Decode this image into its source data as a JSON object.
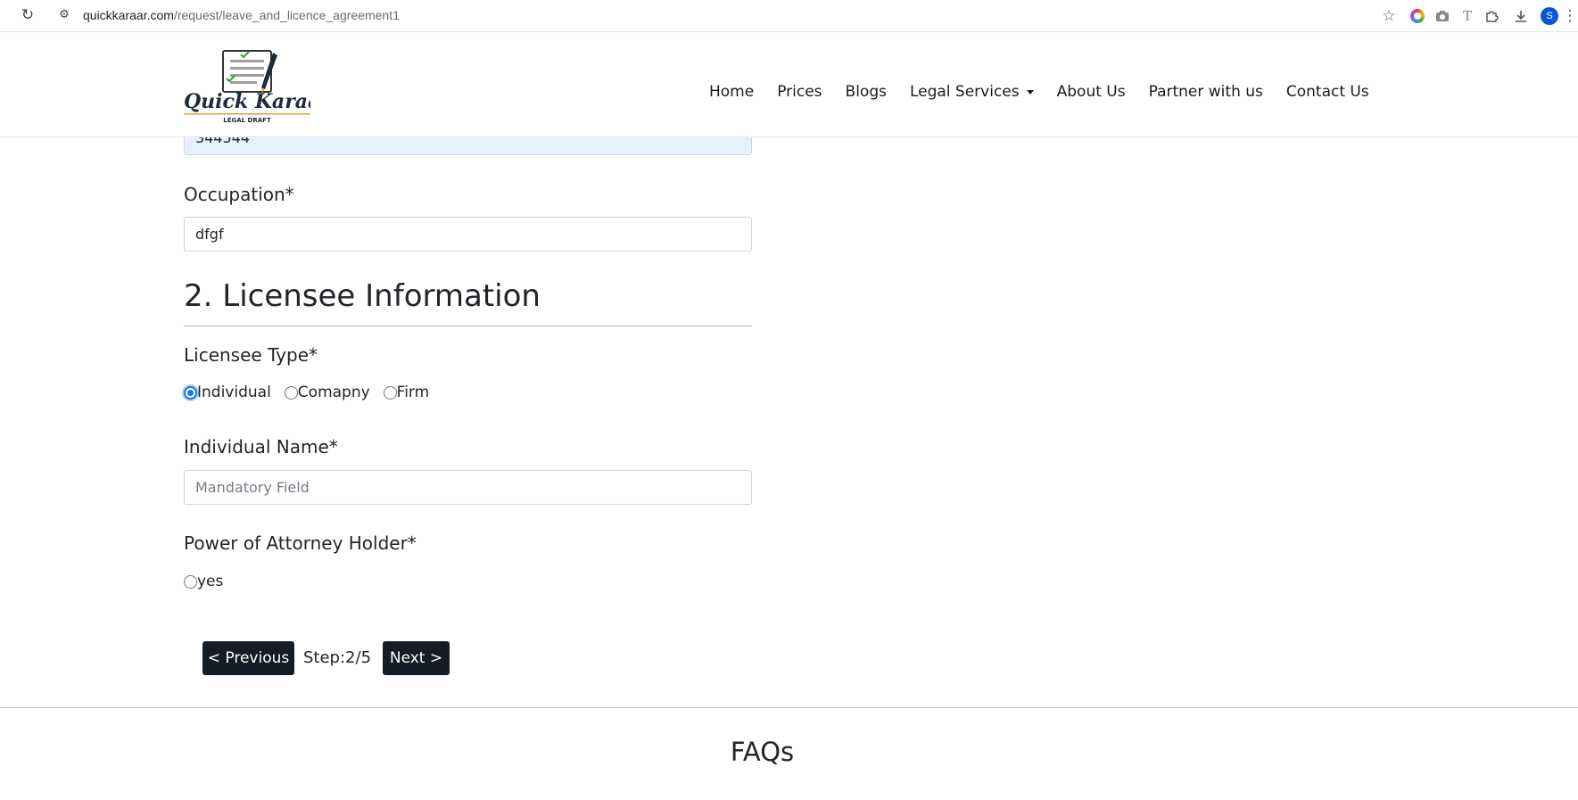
{
  "browser": {
    "url_host": "quickkaraar.com",
    "url_path": "/request/leave_and_licence_agreement1",
    "profile_initial": "S"
  },
  "logo": {
    "text": "Quick Karaar",
    "tagline": "LEGAL DRAFT"
  },
  "nav": {
    "items": [
      "Home",
      "Prices",
      "Blogs",
      "Legal Services",
      "About Us",
      "Partner with us",
      "Contact Us"
    ]
  },
  "form": {
    "pincode_value": "344544",
    "occupation_label": "Occupation*",
    "occupation_value": "dfgf",
    "section_title": "2. Licensee Information",
    "licensee_type_label": "Licensee Type*",
    "licensee_type_options": [
      "Individual",
      "Comapny",
      "Firm"
    ],
    "licensee_type_selected": "Individual",
    "individual_name_label": "Individual Name*",
    "individual_name_placeholder": "Mandatory Field",
    "poa_label": "Power of Attorney Holder*",
    "poa_option": "yes"
  },
  "pager": {
    "previous_label": "< Previous",
    "step_text": "Step:2/5",
    "next_label": "Next >"
  },
  "faq_title": "FAQs"
}
